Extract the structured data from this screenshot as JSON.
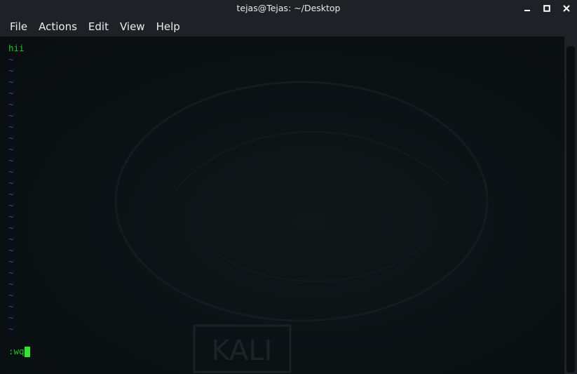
{
  "window": {
    "title": "tejas@Tejas: ~/Desktop",
    "controls": [
      {
        "name": "minimize-icon"
      },
      {
        "name": "maximize-icon"
      },
      {
        "name": "close-icon"
      }
    ]
  },
  "menubar": {
    "items": [
      "File",
      "Actions",
      "Edit",
      "View",
      "Help"
    ]
  },
  "editor": {
    "content_line": "hii",
    "empty_line_marker": "~",
    "command": ":wq"
  },
  "watermark": {
    "text": "KALI"
  },
  "colors": {
    "text_green": "#19c919",
    "tilde_blue": "#3b3bd8",
    "cursor_green": "#2ee62e",
    "terminal_bg": "#0b1013",
    "chrome_bg": "#1e2226"
  }
}
